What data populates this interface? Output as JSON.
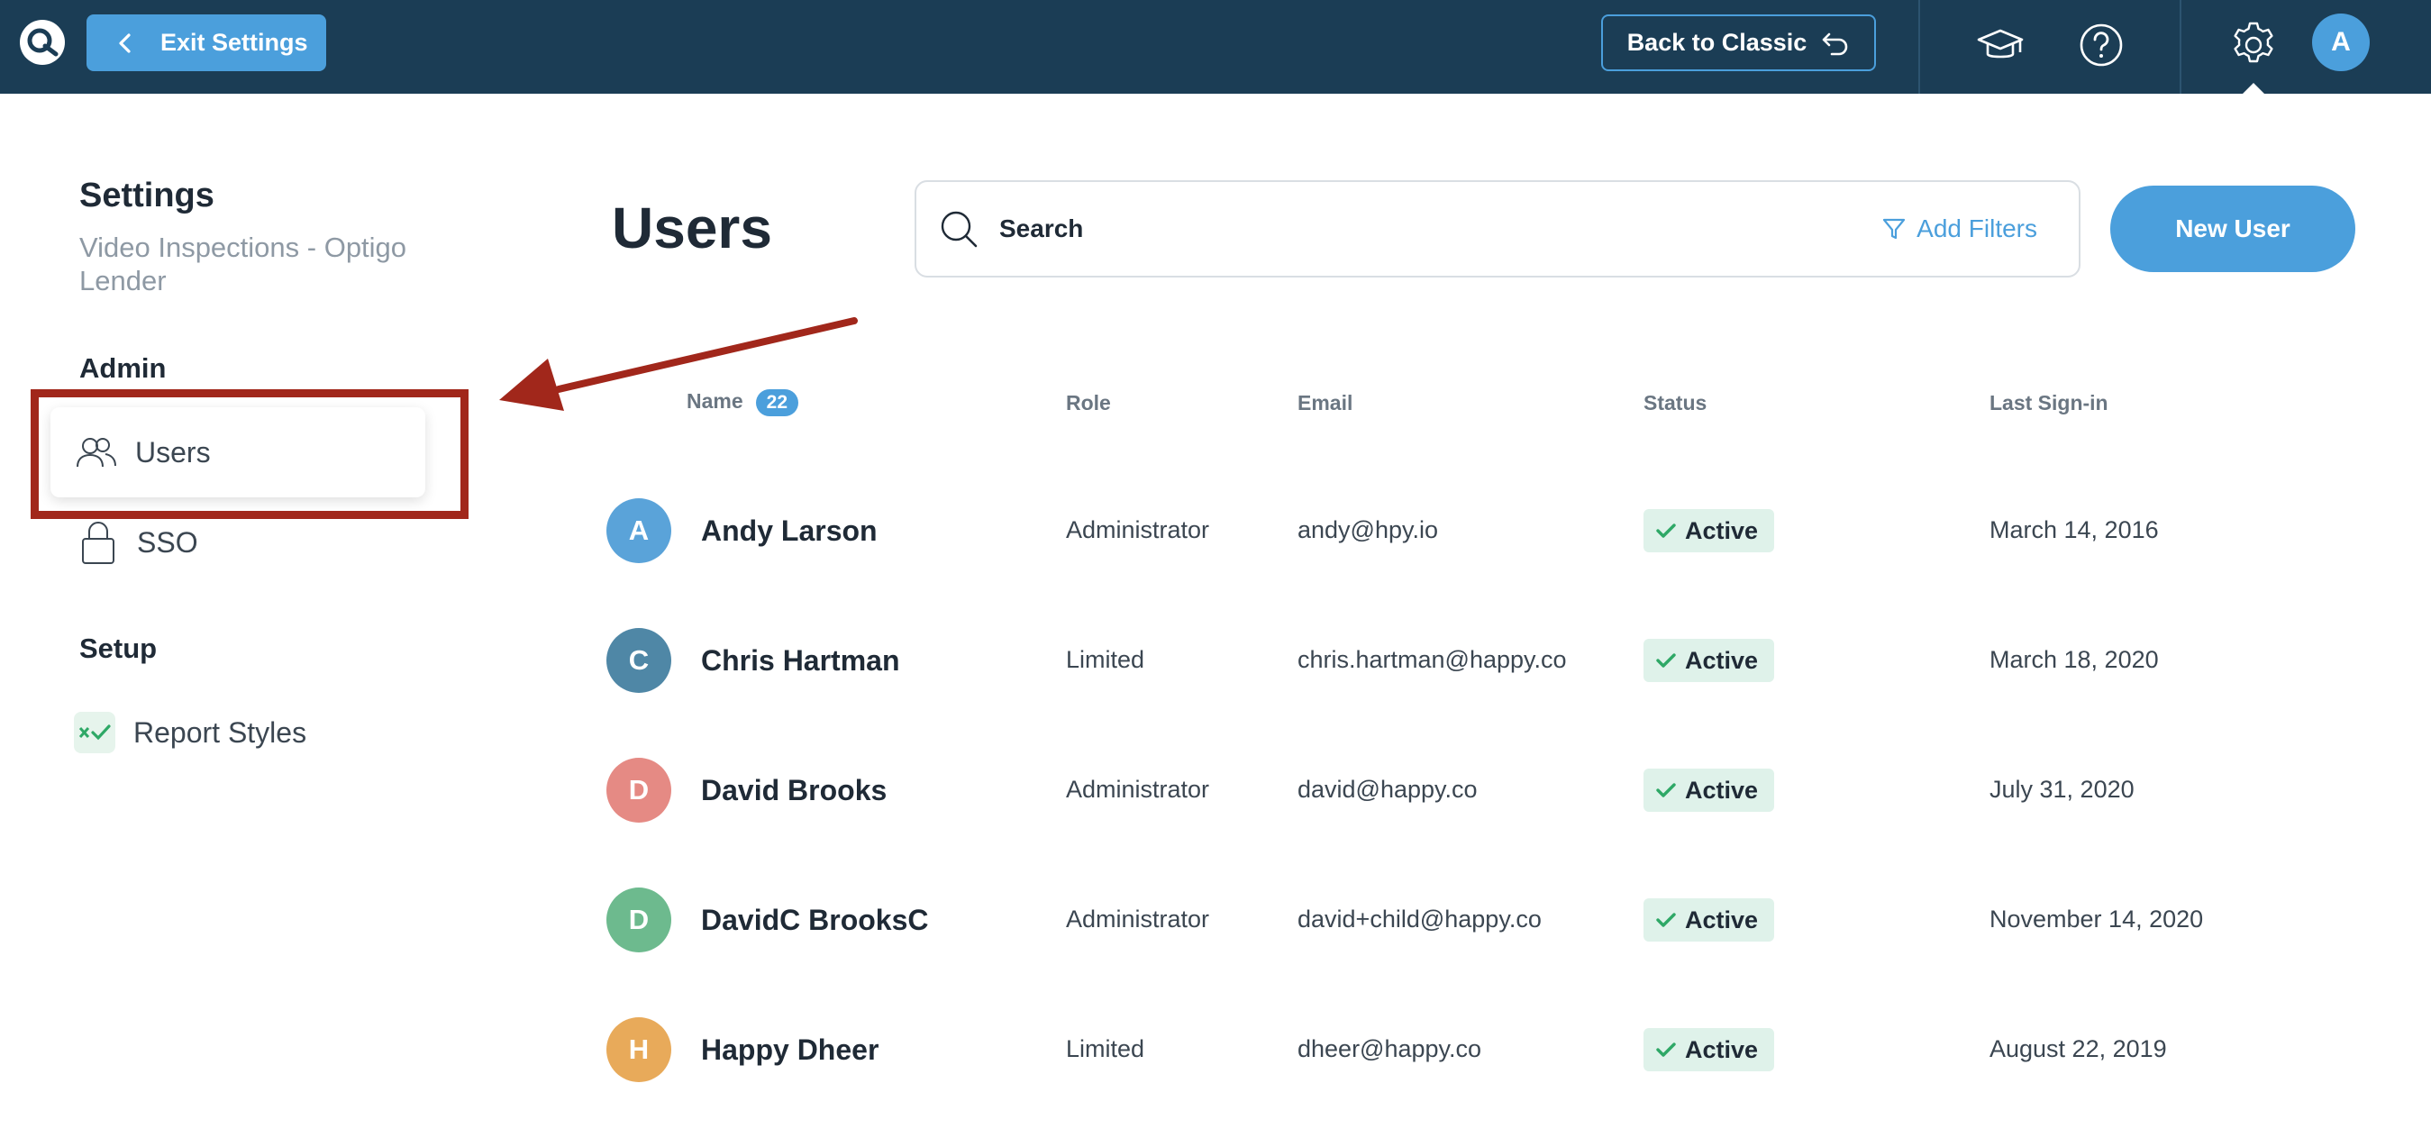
{
  "topbar": {
    "exit_label": "Exit Settings",
    "classic_label": "Back to Classic",
    "avatar_initial": "A",
    "bg_color": "#1b3d55",
    "accent_color": "#4b9fdc"
  },
  "sidebar": {
    "title": "Settings",
    "subtitle": "Video Inspections - Optigo Lender",
    "sections": [
      {
        "title": "Admin",
        "items": [
          {
            "label": "Users",
            "icon": "users-icon",
            "active": true
          },
          {
            "label": "SSO",
            "icon": "lock-icon"
          }
        ]
      },
      {
        "title": "Setup",
        "items": [
          {
            "label": "Report Styles",
            "icon": "report-styles-icon"
          }
        ]
      }
    ]
  },
  "main": {
    "title": "Users",
    "search_placeholder": "Search",
    "add_filters_label": "Add Filters",
    "new_user_label": "New User",
    "columns": {
      "name": "Name",
      "role": "Role",
      "email": "Email",
      "status": "Status",
      "last_sign_in": "Last Sign-in"
    },
    "user_count": "22",
    "users": [
      {
        "initial": "A",
        "name": "Andy Larson",
        "role": "Administrator",
        "email": "andy@hpy.io",
        "status": "Active",
        "last_sign_in": "March 14, 2016",
        "avatar_color": "#5aa3d9"
      },
      {
        "initial": "C",
        "name": "Chris Hartman",
        "role": "Limited",
        "email": "chris.hartman@happy.co",
        "status": "Active",
        "last_sign_in": "March 18, 2020",
        "avatar_color": "#4f87a6"
      },
      {
        "initial": "D",
        "name": "David Brooks",
        "role": "Administrator",
        "email": "david@happy.co",
        "status": "Active",
        "last_sign_in": "July 31, 2020",
        "avatar_color": "#e58a84"
      },
      {
        "initial": "D",
        "name": "DavidC BrooksC",
        "role": "Administrator",
        "email": "david+child@happy.co",
        "status": "Active",
        "last_sign_in": "November 14, 2020",
        "avatar_color": "#6dba8e"
      },
      {
        "initial": "H",
        "name": "Happy Dheer",
        "role": "Limited",
        "email": "dheer@happy.co",
        "status": "Active",
        "last_sign_in": "August 22, 2019",
        "avatar_color": "#e8aa5a"
      }
    ]
  }
}
